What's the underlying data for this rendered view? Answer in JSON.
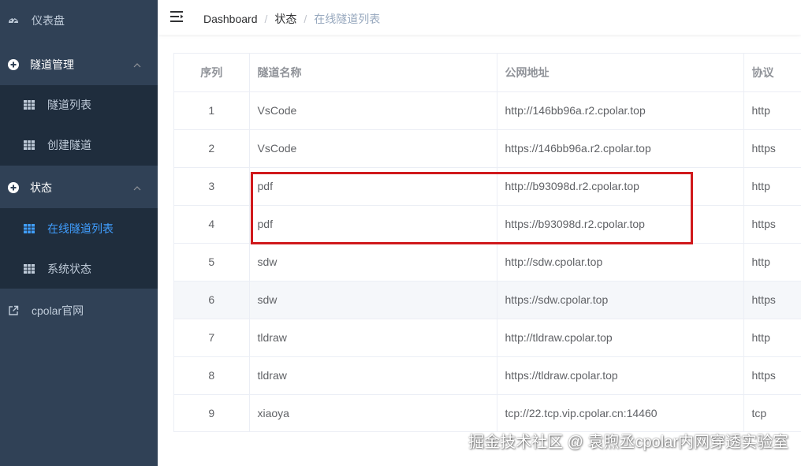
{
  "sidebar": {
    "dashboard": "仪表盘",
    "tunnel_mgmt": {
      "title": "隧道管理",
      "items": [
        "隧道列表",
        "创建隧道"
      ]
    },
    "status": {
      "title": "状态",
      "items": [
        "在线隧道列表",
        "系统状态"
      ]
    },
    "external": "cpolar官网",
    "active_item": "在线隧道列表"
  },
  "header": {
    "breadcrumb": [
      "Dashboard",
      "状态",
      "在线隧道列表"
    ],
    "separator": "/"
  },
  "table": {
    "columns": [
      "序列",
      "隧道名称",
      "公网地址",
      "协议"
    ],
    "rows": [
      [
        "1",
        "VsCode",
        "http://146bb96a.r2.cpolar.top",
        "http"
      ],
      [
        "2",
        "VsCode",
        "https://146bb96a.r2.cpolar.top",
        "https"
      ],
      [
        "3",
        "pdf",
        "http://b93098d.r2.cpolar.top",
        "http"
      ],
      [
        "4",
        "pdf",
        "https://b93098d.r2.cpolar.top",
        "https"
      ],
      [
        "5",
        "sdw",
        "http://sdw.cpolar.top",
        "http"
      ],
      [
        "6",
        "sdw",
        "https://sdw.cpolar.top",
        "https"
      ],
      [
        "7",
        "tldraw",
        "http://tldraw.cpolar.top",
        "http"
      ],
      [
        "8",
        "tldraw",
        "https://tldraw.cpolar.top",
        "https"
      ],
      [
        "9",
        "xiaoya",
        "tcp://22.tcp.vip.cpolar.cn:14460",
        "tcp"
      ]
    ]
  },
  "watermark": "掘金技术社区 @ 袁煦丞cpolar内网穿透实验室",
  "colors": {
    "sidebar_bg": "#304156",
    "submenu_bg": "#1f2d3d",
    "active": "#409eff",
    "highlight": "#d0191c"
  }
}
